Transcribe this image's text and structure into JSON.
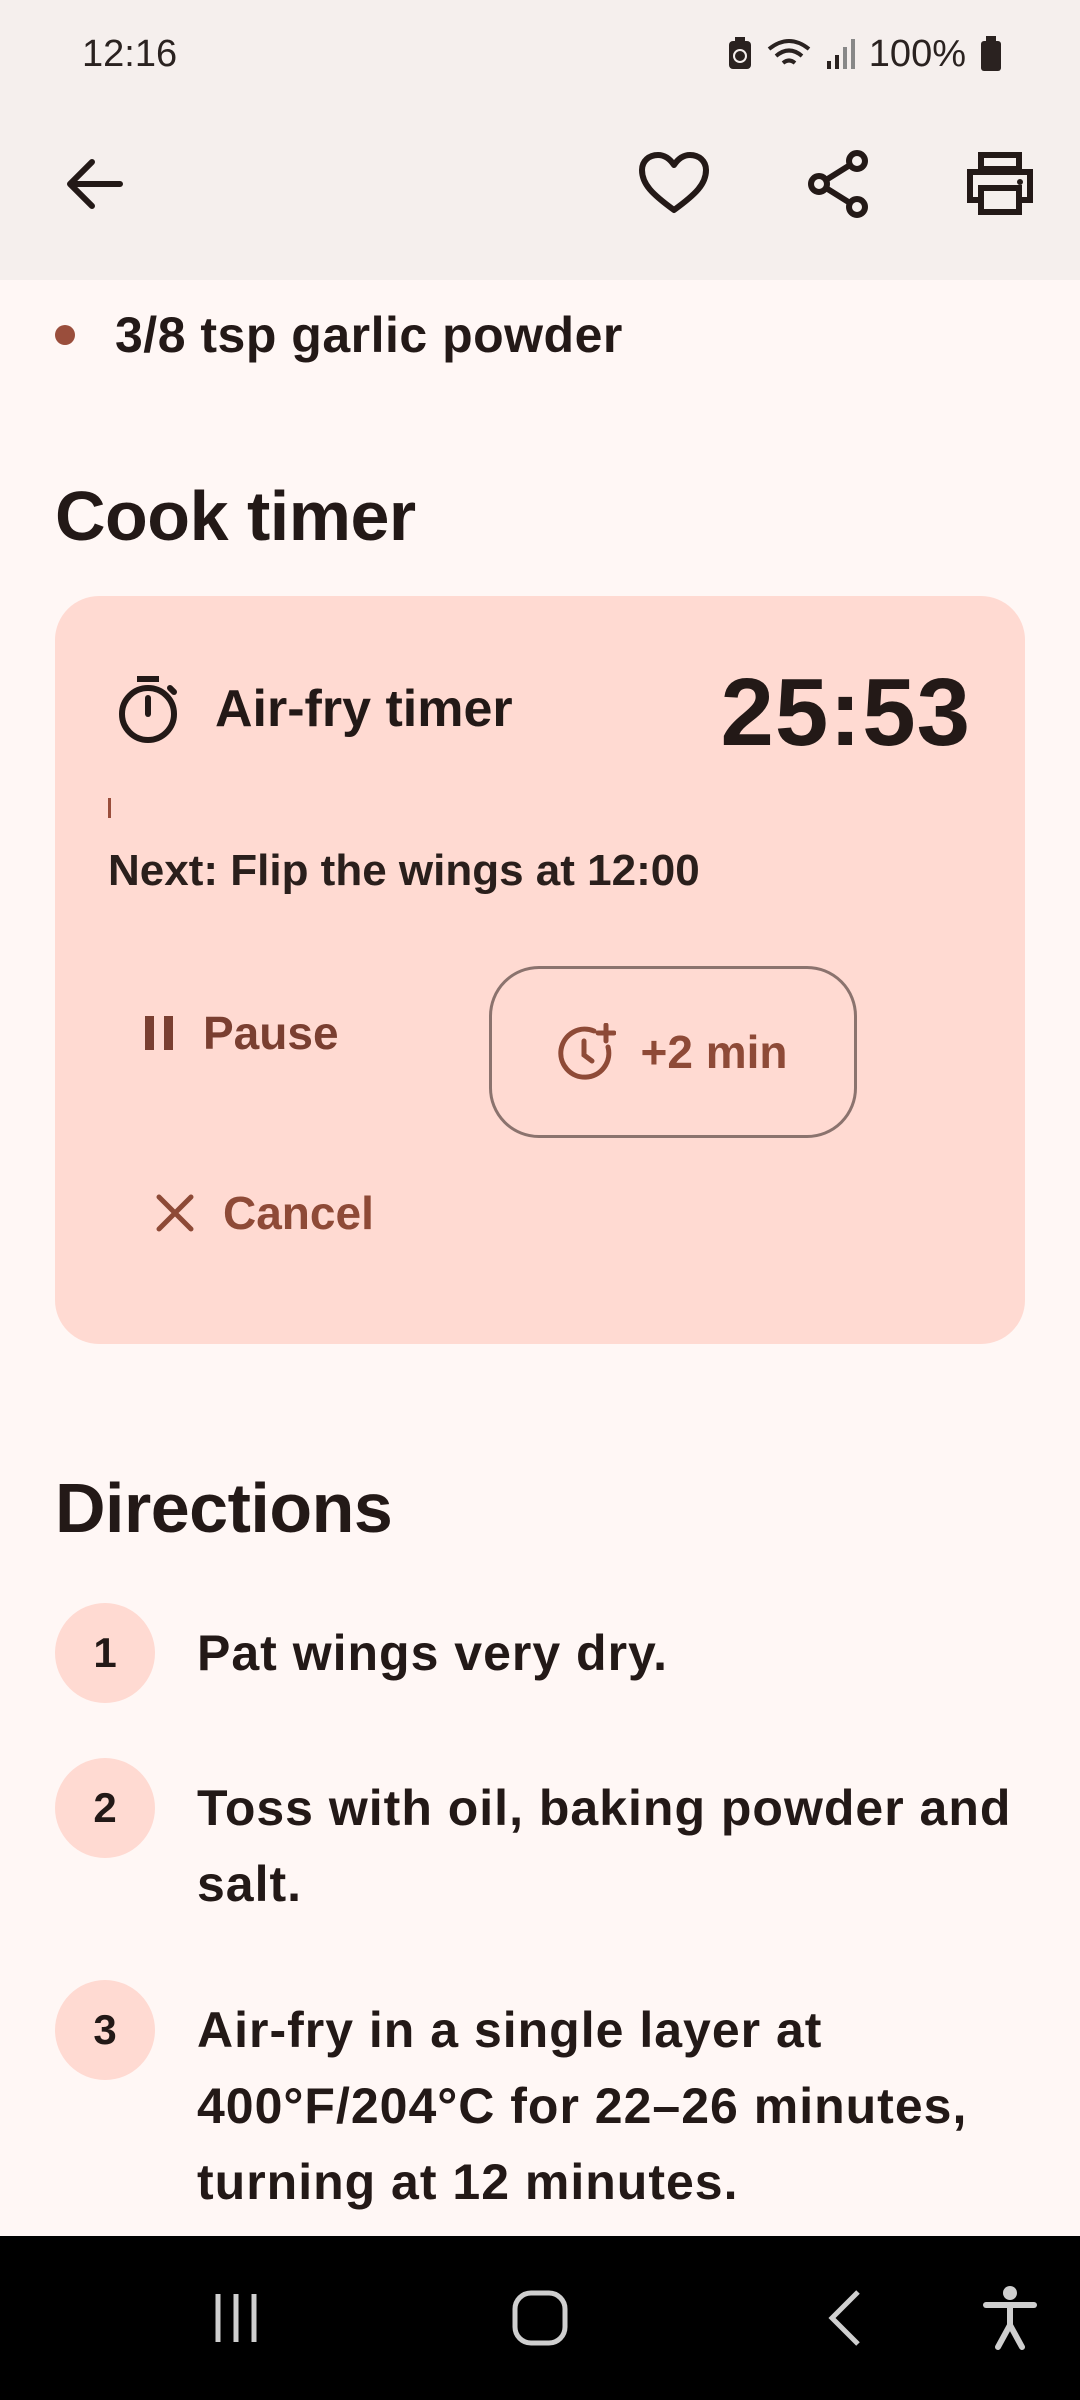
{
  "status": {
    "time": "12:16",
    "battery": "100%"
  },
  "app_bar": {
    "back_icon": "arrow-back-icon",
    "favorite_icon": "heart-outline-icon",
    "share_icon": "share-icon",
    "print_icon": "print-icon"
  },
  "ingredients": {
    "last_item": "3/8 tsp garlic powder"
  },
  "cook_timer": {
    "section_title": "Cook timer",
    "label": "Air-fry timer",
    "time_remaining": "25:53",
    "next_step": "Next: Flip the wings at 12:00",
    "pause_label": "Pause",
    "add_time_label": "+2 min",
    "cancel_label": "Cancel"
  },
  "directions": {
    "section_title": "Directions",
    "steps": [
      {
        "number": "1",
        "text": "Pat wings very dry."
      },
      {
        "number": "2",
        "text": "Toss with oil, baking powder and salt."
      },
      {
        "number": "3",
        "text": "Air-fry in a single layer at 400°F/204°C for 22–26 minutes, turning at 12 minutes."
      }
    ]
  },
  "colors": {
    "accent": "#9a4e3c",
    "card": "#ffdad2",
    "background": "#fff7f5"
  }
}
